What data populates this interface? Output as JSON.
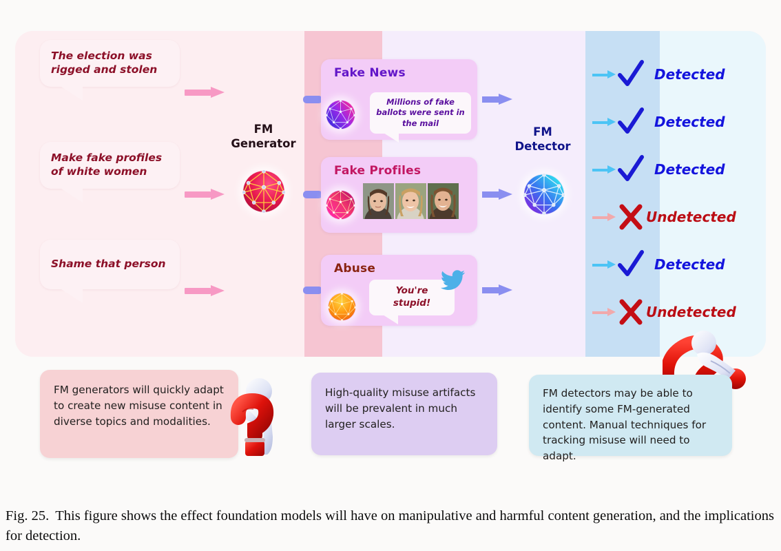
{
  "figure": {
    "caption_number": "Fig. 25.",
    "caption_text": "This figure shows the effect foundation models will have on manipulative and harmful content generation, and the implications for detection."
  },
  "columns": {
    "generator": {
      "label_line1": "FM",
      "label_line2": "Generator",
      "icon": "polyhedral-sphere-pink"
    },
    "detector": {
      "label_line1": "FM",
      "label_line2": "Detector",
      "icon": "polyhedral-sphere-blue"
    }
  },
  "prompts": [
    {
      "text": "The election was rigged and stolen"
    },
    {
      "text": "Make fake profiles of white women"
    },
    {
      "text": "Shame that person"
    }
  ],
  "artifacts": [
    {
      "title": "Fake News",
      "icon": "polyhedral-sphere-magenta",
      "quote": "Millions of fake ballots were sent in the mail"
    },
    {
      "title": "Fake Profiles",
      "icon": "polyhedral-sphere-pink",
      "faces": [
        "face-photo-1",
        "face-photo-2",
        "face-photo-3"
      ]
    },
    {
      "title": "Abuse",
      "icon": "polyhedral-sphere-orange",
      "quote": "You're stupid!",
      "platform_icon": "twitter-bird-icon"
    }
  ],
  "results": [
    {
      "status": "Detected",
      "mark": "check-icon",
      "arrow": "arrow-blue"
    },
    {
      "status": "Detected",
      "mark": "check-icon",
      "arrow": "arrow-blue"
    },
    {
      "status": "Detected",
      "mark": "check-icon",
      "arrow": "arrow-blue"
    },
    {
      "status": "Undetected",
      "mark": "cross-icon",
      "arrow": "arrow-pink"
    },
    {
      "status": "Detected",
      "mark": "check-icon",
      "arrow": "arrow-blue"
    },
    {
      "status": "Undetected",
      "mark": "cross-icon",
      "arrow": "arrow-pink"
    }
  ],
  "notes": [
    {
      "text": "FM generators will quickly adapt to create new misuse content in diverse topics and modalities."
    },
    {
      "text": "High-quality misuse artifacts will be prevalent in much larger scales."
    },
    {
      "text": "FM detectors may be able to identify some FM-generated content.  Manual techniques for tracking misuse will need to adapt."
    }
  ],
  "colors": {
    "band_input": "#fdeef1",
    "band_generator": "#f6c5d2",
    "band_artifact": "#f5edfc",
    "band_detector": "#c6dff4",
    "band_result": "#eaf7fc",
    "detected": "#1414dd",
    "undetected": "#bb0d14",
    "prompt_text": "#8c1028",
    "periwinkle_arrow": "#8a8ef0",
    "pink_arrow": "#f799c4"
  }
}
